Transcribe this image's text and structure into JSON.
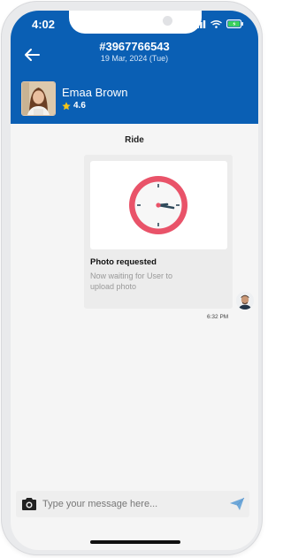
{
  "status_bar": {
    "time": "4:02"
  },
  "header": {
    "order_id": "#3967766543",
    "date": "19 Mar, 2024 (Tue)",
    "driver_name": "Emaa Brown",
    "rating": "4.6",
    "accent_color": "#0a5fb4"
  },
  "conversation": {
    "section_title": "Ride",
    "message": {
      "title": "Photo requested",
      "text": "Now waiting for User to upload photo",
      "time": "6:32 PM",
      "icon": "clock-icon"
    }
  },
  "composer": {
    "placeholder": "Type your message here...",
    "value": ""
  },
  "icons": {
    "back": "back-arrow-icon",
    "camera": "camera-icon",
    "send": "send-icon",
    "star": "star-icon"
  }
}
